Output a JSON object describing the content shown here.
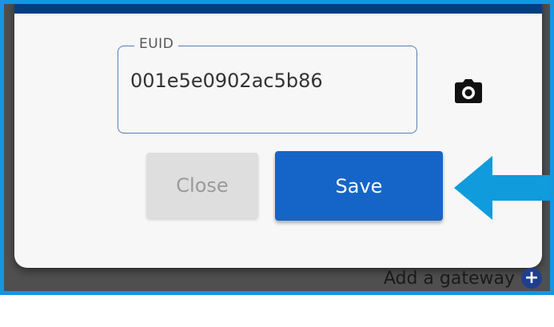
{
  "dialog": {
    "field_label": "EUID",
    "field_value": "001e5e0902ac5b86",
    "camera_icon": "camera-icon",
    "close_label": "Close",
    "save_label": "Save"
  },
  "background": {
    "add_gateway_label": "Add a gateway",
    "add_icon": "plus-circle-icon"
  },
  "annotation": {
    "arrow_icon": "left-arrow-icon",
    "arrow_color": "#0f9bdc"
  },
  "colors": {
    "frame_border": "#1496e0",
    "header": "#003f82",
    "save_button": "#1565c8"
  }
}
